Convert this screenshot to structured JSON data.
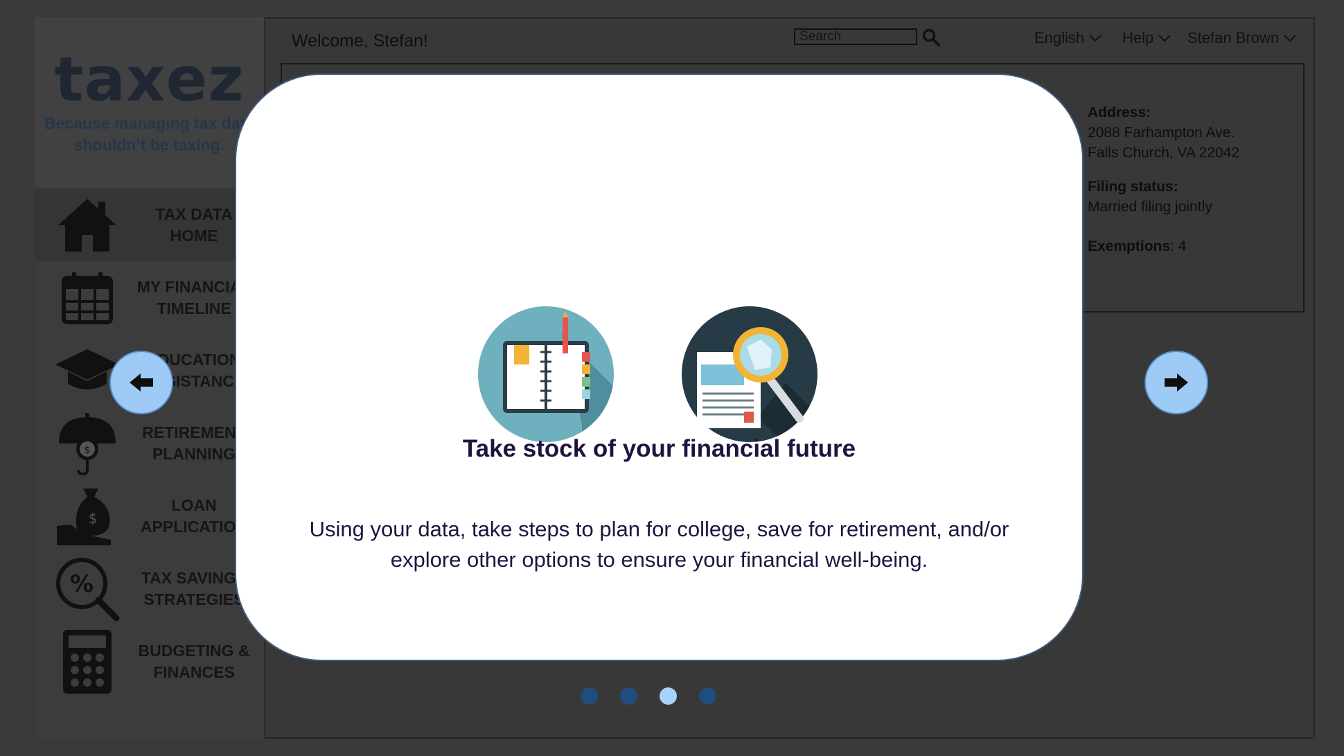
{
  "brand": {
    "logo": "taxez",
    "tagline": "Because managing tax data shouldn’t be taxing."
  },
  "sidebar": {
    "items": [
      {
        "label": "TAX DATA HOME",
        "icon": "house-icon",
        "active": true
      },
      {
        "label": "MY FINANCIAL TIMELINE",
        "icon": "calendar-icon"
      },
      {
        "label": "EDUCATION ASSISTANCE",
        "icon": "graduation-cap-icon"
      },
      {
        "label": "RETIREMENT PLANNING",
        "icon": "umbrella-money-icon"
      },
      {
        "label": "LOAN APPLICATION",
        "icon": "money-bag-hand-icon"
      },
      {
        "label": "TAX SAVINGS STRATEGIES",
        "icon": "percent-magnifier-icon"
      },
      {
        "label": "BUDGETING & FINANCES",
        "icon": "calculator-icon"
      }
    ]
  },
  "header": {
    "welcome": "Welcome, Stefan!",
    "search_placeholder": "Search",
    "language": "English",
    "help": "Help",
    "user": "Stefan Brown"
  },
  "profile": {
    "address_label": "Address:",
    "address_line1": "2088 Farhampton Ave.",
    "address_line2": "Falls Church, VA 22042",
    "filing_label": "Filing status:",
    "filing_value": "Married filing jointly",
    "exemptions_label": "Exemptions",
    "exemptions_value": ": 4"
  },
  "modal": {
    "title": "Take stock of your financial future",
    "body": "Using your data, take steps to plan for college, save for retirement, and/or explore other options to ensure your financial well-being.",
    "images": [
      "notebook-icon",
      "document-magnifier-icon"
    ],
    "slide_index": 3,
    "slide_count": 4
  },
  "colors": {
    "accent_light_blue": "#9ecbf5",
    "dot_dark": "#1f4d7c",
    "dot_active": "#a7d2fb",
    "title_color": "#1f1440"
  }
}
